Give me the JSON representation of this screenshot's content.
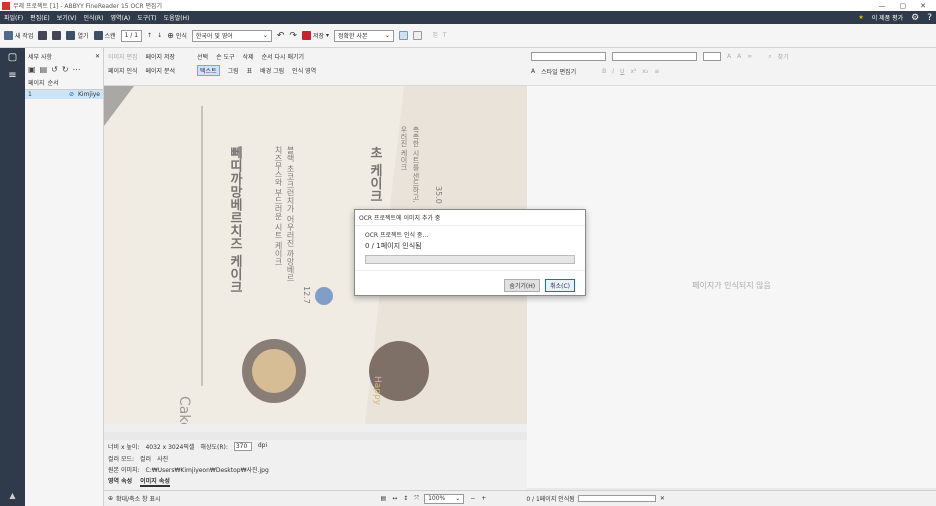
{
  "window": {
    "title": "무제 프로젝트 [1] - ABBYY FineReader 15 OCR 편집기",
    "controls": [
      "—",
      "▢",
      "✕"
    ]
  },
  "menu": {
    "items": [
      "파일(F)",
      "편집(E)",
      "보기(V)",
      "인식(R)",
      "영역(A)",
      "도구(T)",
      "도움말(H)"
    ],
    "rate": "이 제품 평가"
  },
  "toolbar": {
    "new_task": "새 작업",
    "open": "열기",
    "scan": "스캔",
    "page_counter": "1 / 1",
    "recognize": "인식",
    "language": "한국어 및 영어",
    "save": "저장",
    "save_mode": "정확한 사본"
  },
  "pages_panel": {
    "header": "세부 사항",
    "pages_label": "페이지",
    "sort_label": "순서",
    "row_number": "1",
    "row_user": "Kimjiye"
  },
  "image_toolbar": {
    "edit_image": "이미지 편집",
    "save_page": "페이지 저장",
    "recognize_page": "페이지 인식",
    "analyze_page": "페이지 분석",
    "select": "선택",
    "hand": "손 도구",
    "delete": "삭제",
    "reorder": "순서 다시 매기기",
    "text": "텍스트",
    "picture": "그림",
    "table": "표",
    "background_picture": "배경 그림",
    "recognition_area": "인식 영역"
  },
  "image_props": {
    "size_label": "너비 x 높이:",
    "size_value": "4032 x 3024픽셀",
    "resolution_label": "해상도(R):",
    "resolution_value": "370",
    "resolution_unit": "dpi",
    "color_label": "컬러 모드:",
    "color_value": "컬러",
    "type_label": "사진",
    "source_label": "원본 이미지:",
    "source_value": "C:₩Users₩Kimjiyeon₩Desktop₩사진.jpg",
    "tabs": [
      "영역 속성",
      "이미지 속성"
    ]
  },
  "bottom": {
    "zoom_label": "확대/축소 창 표시",
    "zoom_value": "100%",
    "recog_status": "0 / 1페이지 인식됨",
    "not_recognized": "페이지가 인식되지 않음"
  },
  "photo": {
    "title1": "뻬띠까망베르치즈 케이크",
    "title2": "초 케이크",
    "sub1": "블랙 초코크런치가 어우러진 까망베르",
    "sub2": "치즈무스와 부드러운 시트 케이크",
    "side1": "촉촉한 시트를 샌드하고,",
    "side2": "우러진 케이크",
    "num1": "12.7",
    "num2": "35.0",
    "cake": "Cake",
    "brand": "Happy"
  },
  "right_toolbar": {
    "style_editor": "스타일 편집기",
    "search": "찾기"
  },
  "dialog": {
    "title": "OCR 프로젝트에 이미지 추가 중",
    "status": "OCR 프로젝트 인식 중...",
    "progress_text": "0 / 1페이지 인식됨",
    "progress": 0,
    "hide_button": "숨기기(H)",
    "cancel_button": "취소(C)"
  }
}
